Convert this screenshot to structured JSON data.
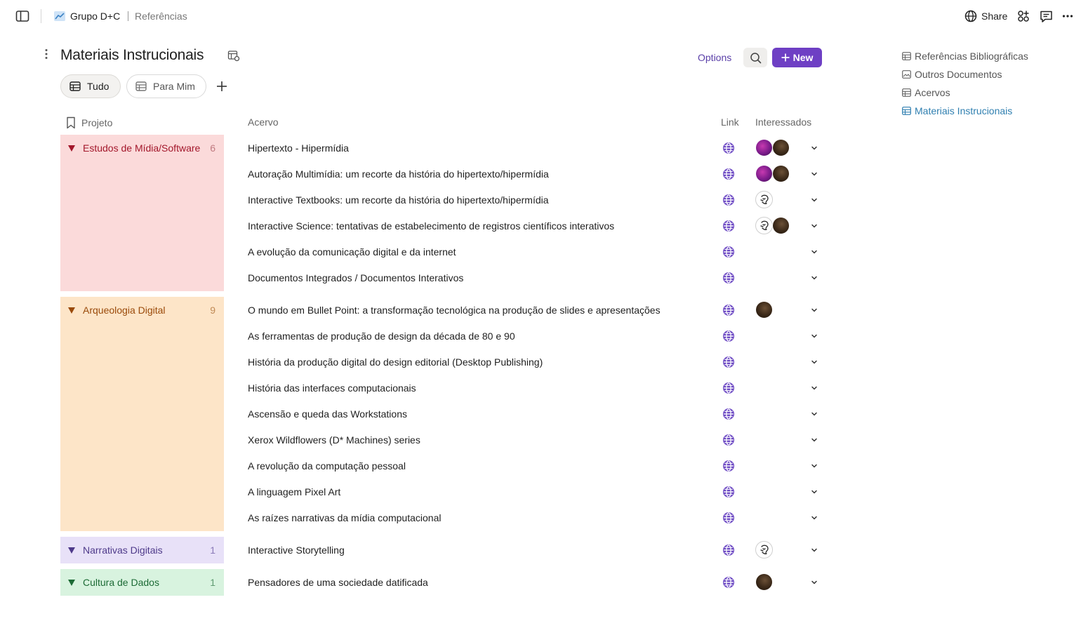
{
  "breadcrumb": {
    "workspace": "Grupo D+C",
    "page": "Referências"
  },
  "topbar": {
    "share_label": "Share"
  },
  "title": "Materiais Instrucionais",
  "toolbar": {
    "options_label": "Options",
    "new_label": "New"
  },
  "tabs": [
    {
      "label": "Tudo"
    },
    {
      "label": "Para Mim"
    }
  ],
  "columns": {
    "projeto": "Projeto",
    "acervo": "Acervo",
    "link": "Link",
    "interessados": "Interessados"
  },
  "groups": [
    {
      "name": "Estudos de Mídia/Software",
      "count": "6"
    },
    {
      "name": "Arqueologia Digital",
      "count": "9"
    },
    {
      "name": "Narrativas Digitais",
      "count": "1"
    },
    {
      "name": "Cultura de Dados",
      "count": "1"
    }
  ],
  "rows": [
    {
      "title": "Hipertexto - Hipermídia"
    },
    {
      "title": "Autoração Multimídia: um recorte da história do hipertexto/hipermídia"
    },
    {
      "title": "Interactive Textbooks: um recorte da história do hipertexto/hipermídia"
    },
    {
      "title": "Interactive Science: tentativas de estabelecimento de registros científicos interativos"
    },
    {
      "title": "A evolução da comunicação digital e da internet"
    },
    {
      "title": "Documentos Integrados / Documentos Interativos"
    },
    {
      "title": "O mundo em Bullet Point: a transformação tecnológica na produção de slides e apresentações"
    },
    {
      "title": "As ferramentas de produção de design da década de 80 e 90"
    },
    {
      "title": "História da produção digital do design editorial (Desktop Publishing)"
    },
    {
      "title": "História das interfaces computacionais"
    },
    {
      "title": "Ascensão e queda das Workstations"
    },
    {
      "title": "Xerox Wildflowers (D* Machines) series"
    },
    {
      "title": "A revolução da computação pessoal"
    },
    {
      "title": "A linguagem Pixel Art"
    },
    {
      "title": "As raízes narrativas da mídia computacional"
    },
    {
      "title": "Interactive Storytelling"
    },
    {
      "title": "Pensadores de uma sociedade datificada"
    }
  ],
  "sidebar_nav": [
    {
      "label": "Referências Bibliográficas"
    },
    {
      "label": "Outros Documentos"
    },
    {
      "label": "Acervos"
    },
    {
      "label": "Materiais Instrucionais"
    }
  ],
  "colors": {
    "accent": "#6e3fc4",
    "nav_active": "#2f7fb0",
    "group_1_bg": "#fbdada",
    "group_1_fg": "#a3172b",
    "group_2_bg": "#fde5c8",
    "group_2_fg": "#9a4a0a",
    "group_3_bg": "#e8e1f8",
    "group_3_fg": "#4e3a8a",
    "group_4_bg": "#d8f3df",
    "group_4_fg": "#1d6b36"
  }
}
